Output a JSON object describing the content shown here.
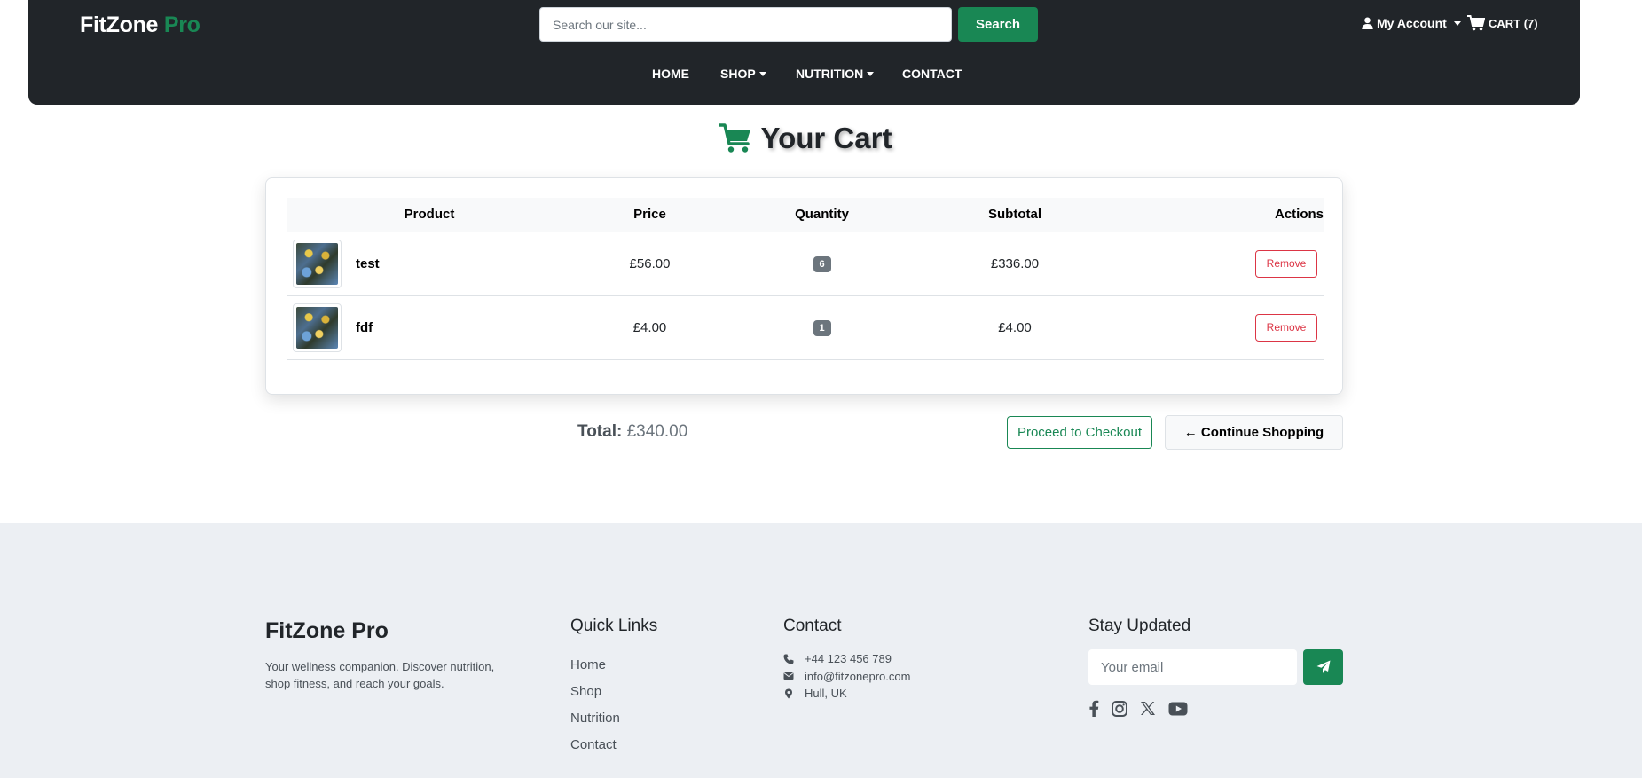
{
  "header": {
    "brand_main": "FitZone",
    "brand_accent": "Pro",
    "search_placeholder": "Search our site...",
    "search_button": "Search",
    "account_label": "My Account",
    "cart_label": "CART (7)",
    "nav": [
      {
        "label": "HOME",
        "dropdown": false
      },
      {
        "label": "SHOP",
        "dropdown": true
      },
      {
        "label": "NUTRITION",
        "dropdown": true
      },
      {
        "label": "CONTACT",
        "dropdown": false
      }
    ]
  },
  "page": {
    "title": "Your Cart",
    "icon": "cart-icon",
    "accent_color": "#198754"
  },
  "cart": {
    "columns": [
      "Product",
      "Price",
      "Quantity",
      "Subtotal",
      "Actions"
    ],
    "items": [
      {
        "name": "test",
        "price": "£56.00",
        "quantity": "6",
        "subtotal": "£336.00",
        "action": "Remove"
      },
      {
        "name": "fdf",
        "price": "£4.00",
        "quantity": "1",
        "subtotal": "£4.00",
        "action": "Remove"
      }
    ],
    "total_label": "Total:",
    "total_value": "£340.00",
    "checkout_button": "Proceed to Checkout",
    "continue_button": "← Continue Shopping"
  },
  "footer": {
    "brand": "FitZone Pro",
    "description": "Your wellness companion. Discover nutrition, shop fitness, and reach your goals.",
    "quick_links_heading": "Quick Links",
    "quick_links": [
      "Home",
      "Shop",
      "Nutrition",
      "Contact"
    ],
    "contact_heading": "Contact",
    "contact": [
      {
        "icon": "phone-icon",
        "text": "+44 123 456 789"
      },
      {
        "icon": "envelope-icon",
        "text": "info@fitzonepro.com"
      },
      {
        "icon": "map-pin-icon",
        "text": "Hull, UK"
      }
    ],
    "newsletter_heading": "Stay Updated",
    "email_placeholder": "Your email",
    "socials": [
      "facebook-icon",
      "instagram-icon",
      "x-icon",
      "youtube-icon"
    ]
  }
}
